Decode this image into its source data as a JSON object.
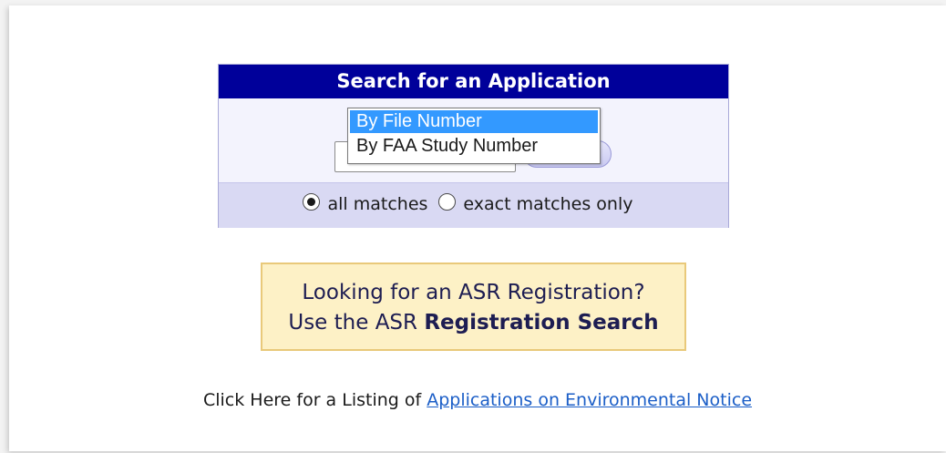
{
  "search_panel": {
    "title": "Search for an Application",
    "search_button_label": "",
    "listbox_options": [
      "By File Number",
      "By FAA Study Number"
    ],
    "selected_option": "By File Number",
    "radio": {
      "all_label": "all matches",
      "exact_label": "exact matches only",
      "selected": "all matches"
    }
  },
  "asr_box": {
    "line1": "Looking for an ASR Registration?",
    "line2_prefix": "Use the ASR",
    "line2_bold": "Registration Search"
  },
  "env_notice": {
    "prefix": "Click Here for a Listing of ",
    "link": "Applications on Environmental Notice"
  },
  "colors": {
    "header_bg": "#00009a",
    "footer_bg": "#d9d9f3",
    "selected_option_bg": "#3399ff",
    "asr_bg": "#fdf1c6",
    "asr_border": "#e9c97a",
    "link": "#1b5ec7"
  }
}
